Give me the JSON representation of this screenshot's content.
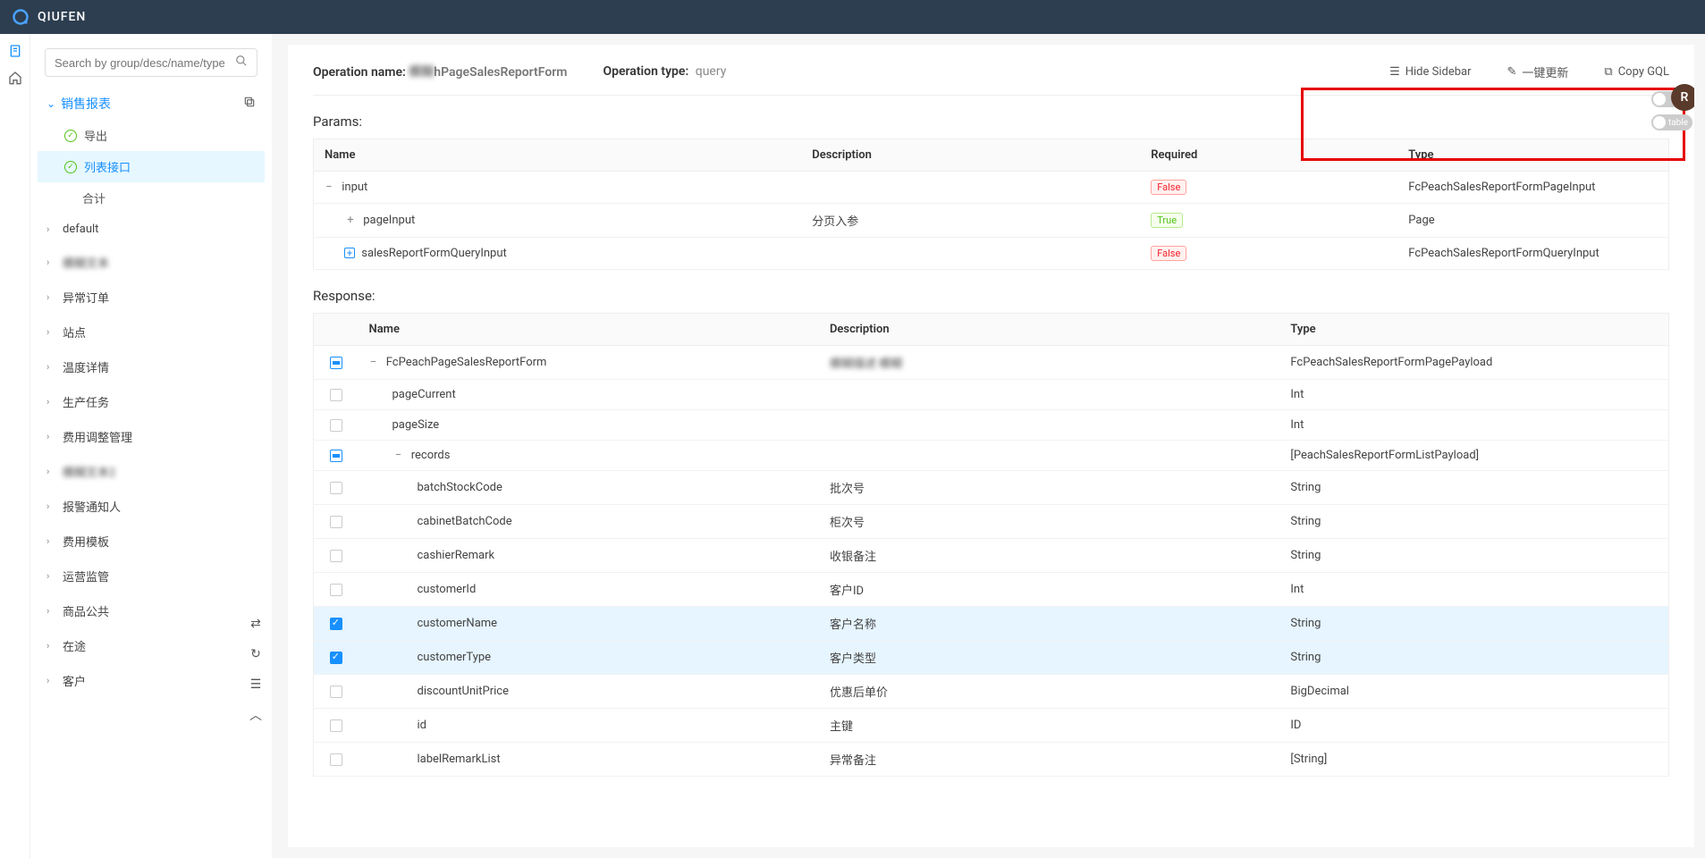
{
  "app": {
    "title": "QIUFEN"
  },
  "search": {
    "placeholder": "Search by group/desc/name/type"
  },
  "sidebar": {
    "activeGroup": "销售报表",
    "items": [
      {
        "label": "导出",
        "check": true,
        "active": false
      },
      {
        "label": "列表接口",
        "check": true,
        "active": true
      },
      {
        "label": "合计",
        "check": false,
        "active": false
      }
    ],
    "sections": [
      "default",
      "模糊文本",
      "异常订单",
      "站点",
      "温度详情",
      "生产任务",
      "费用调整管理",
      "模糊文本2",
      "报警通知人",
      "费用模板",
      "运营监管",
      "商品公共",
      "在途",
      "客户"
    ]
  },
  "operation": {
    "nameLabel": "Operation name:",
    "nameValueBlur": "模糊",
    "nameValueRest": "hPageSalesReportForm",
    "typeLabel": "Operation type:",
    "typeValue": "query"
  },
  "actions": {
    "hideSidebar": "Hide Sidebar",
    "refresh": "一键更新",
    "copyGql": "Copy GQL",
    "diffToggle": "diff",
    "tableToggle": "table"
  },
  "avatar": "R",
  "paramsTitle": "Params:",
  "paramsHeaders": {
    "name": "Name",
    "desc": "Description",
    "req": "Required",
    "type": "Type"
  },
  "params": [
    {
      "exp": "−",
      "indent": 0,
      "name": "input",
      "desc": "",
      "req": "False",
      "type": "FcPeachSalesReportFormPageInput"
    },
    {
      "exp": "+",
      "indent": 1,
      "name": "pageInput",
      "desc": "分页入参",
      "req": "True",
      "type": "Page"
    },
    {
      "exp": "⊕",
      "indent": 1,
      "name": "salesReportFormQueryInput",
      "desc": "",
      "req": "False",
      "type": "FcPeachSalesReportFormQueryInput"
    }
  ],
  "responseTitle": "Response:",
  "responseHeaders": {
    "name": "Name",
    "desc": "Description",
    "type": "Type"
  },
  "response": [
    {
      "cb": "partial",
      "exp": "−",
      "indent": 0,
      "name": "FcPeachPageSalesReportForm",
      "desc": "模糊描述 模糊",
      "type": "FcPeachSalesReportFormPagePayload",
      "descBlur": true
    },
    {
      "cb": "",
      "exp": "",
      "indent": 1,
      "name": "pageCurrent",
      "desc": "",
      "type": "Int"
    },
    {
      "cb": "",
      "exp": "",
      "indent": 1,
      "name": "pageSize",
      "desc": "",
      "type": "Int"
    },
    {
      "cb": "partial",
      "exp": "−",
      "indent": 1,
      "name": "records",
      "desc": "",
      "type": "[PeachSalesReportFormListPayload]"
    },
    {
      "cb": "",
      "exp": "",
      "indent": 2,
      "name": "batchStockCode",
      "desc": "批次号",
      "type": "String"
    },
    {
      "cb": "",
      "exp": "",
      "indent": 2,
      "name": "cabinetBatchCode",
      "desc": "柜次号",
      "type": "String"
    },
    {
      "cb": "",
      "exp": "",
      "indent": 2,
      "name": "cashierRemark",
      "desc": "收银备注",
      "type": "String"
    },
    {
      "cb": "",
      "exp": "",
      "indent": 2,
      "name": "customerId",
      "desc": "客户ID",
      "type": "Int"
    },
    {
      "cb": "checked",
      "exp": "",
      "indent": 2,
      "name": "customerName",
      "desc": "客户名称",
      "type": "String",
      "sel": true
    },
    {
      "cb": "checked",
      "exp": "",
      "indent": 2,
      "name": "customerType",
      "desc": "客户类型",
      "type": "String",
      "sel": true
    },
    {
      "cb": "",
      "exp": "",
      "indent": 2,
      "name": "discountUnitPrice",
      "desc": "优惠后单价",
      "type": "BigDecimal"
    },
    {
      "cb": "",
      "exp": "",
      "indent": 2,
      "name": "id",
      "desc": "主键",
      "type": "ID"
    },
    {
      "cb": "",
      "exp": "",
      "indent": 2,
      "name": "labelRemarkList",
      "desc": "异常备注",
      "type": "[String]"
    }
  ]
}
